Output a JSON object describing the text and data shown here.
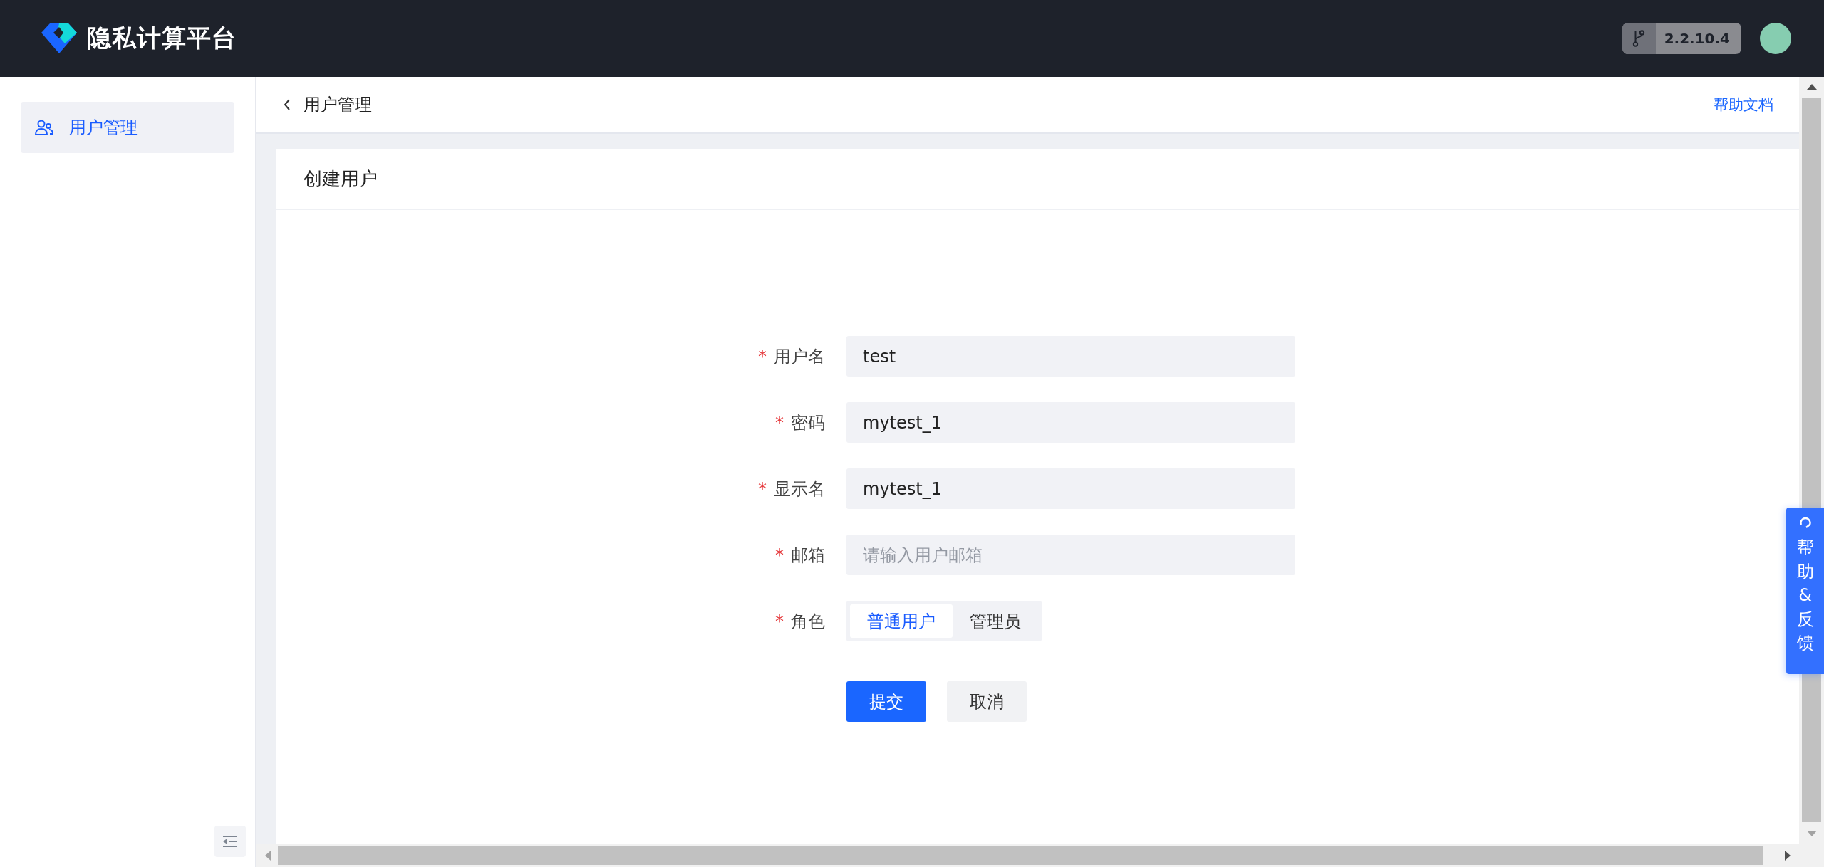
{
  "header": {
    "logo_text": "隐私计算平台",
    "version": "2.2.10.4"
  },
  "sidebar": {
    "items": [
      {
        "label": "用户管理",
        "selected": true
      }
    ]
  },
  "breadcrumb": {
    "title": "用户管理",
    "help_link": "帮助文档"
  },
  "card": {
    "title": "创建用户"
  },
  "form": {
    "fields": [
      {
        "kind": "input",
        "required_mark": "*",
        "label": "用户名",
        "value": "test"
      },
      {
        "kind": "input",
        "required_mark": "*",
        "label": "密码",
        "value": "mytest_1"
      },
      {
        "kind": "input",
        "required_mark": "*",
        "label": "显示名",
        "value": "mytest_1"
      },
      {
        "kind": "input",
        "required_mark": "*",
        "label": "邮箱",
        "placeholder": "请输入用户邮箱"
      },
      {
        "kind": "segmented",
        "required_mark": "*",
        "label": "角色",
        "options": [
          {
            "label": "普通用户",
            "selected": true
          },
          {
            "label": "管理员",
            "selected": false
          }
        ]
      }
    ],
    "buttons": [
      {
        "label": "提交",
        "kind": "primary"
      },
      {
        "label": "取消",
        "kind": "secondary"
      }
    ]
  },
  "feedback_tab": {
    "label": "帮助&反馈"
  }
}
